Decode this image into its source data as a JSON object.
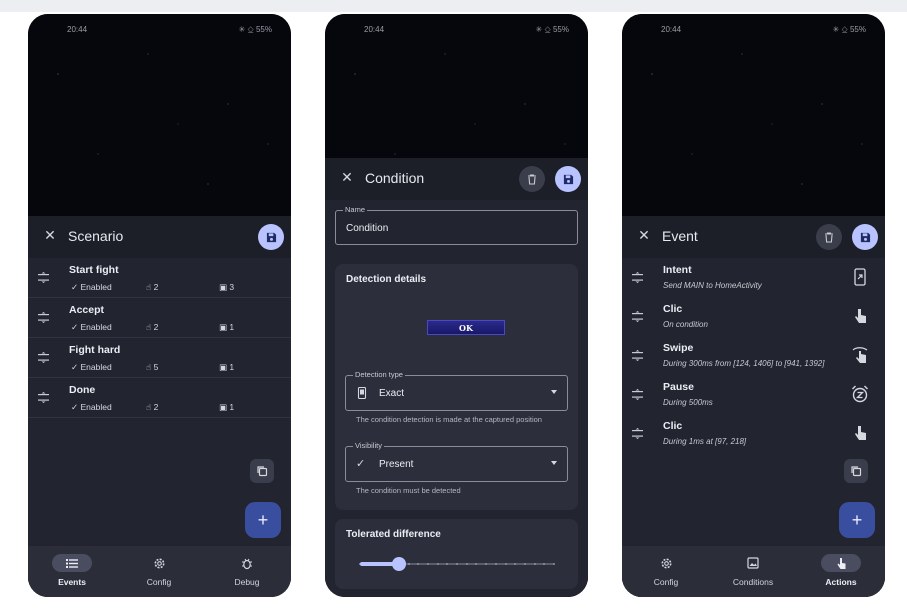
{
  "status": {
    "time": "20:44",
    "battery": "✳ ⎐ 55%"
  },
  "scenario": {
    "title": "Scenario",
    "events": [
      {
        "name": "Start fight",
        "enabled": "Enabled",
        "actions": "2",
        "conditions": "3"
      },
      {
        "name": "Accept",
        "enabled": "Enabled",
        "actions": "2",
        "conditions": "1"
      },
      {
        "name": "Fight hard",
        "enabled": "Enabled",
        "actions": "5",
        "conditions": "1"
      },
      {
        "name": "Done",
        "enabled": "Enabled",
        "actions": "2",
        "conditions": "1"
      }
    ],
    "fab_label": "+",
    "nav": [
      {
        "label": "Events"
      },
      {
        "label": "Config"
      },
      {
        "label": "Debug"
      }
    ]
  },
  "condition": {
    "title": "Condition",
    "name_label": "Name",
    "name_value": "Condition",
    "detection_title": "Detection details",
    "image_text": "OK",
    "detection_type_label": "Detection type",
    "detection_type_value": "Exact",
    "detection_helper": "The condition detection is made at the captured position",
    "visibility_label": "Visibility",
    "visibility_value": "Present",
    "visibility_helper": "The condition must be detected",
    "tolerance_title": "Tolerated difference",
    "slider_fraction": 0.2
  },
  "event": {
    "title": "Event",
    "actions": [
      {
        "name": "Intent",
        "desc": "Send MAIN to HomeActivity",
        "icon": "intent-icon"
      },
      {
        "name": "Clic",
        "desc": "On condition",
        "icon": "click-icon"
      },
      {
        "name": "Swipe",
        "desc": "During 300ms from [124, 1406] to [941, 1392]",
        "icon": "swipe-icon"
      },
      {
        "name": "Pause",
        "desc": "During 500ms",
        "icon": "alarm-icon"
      },
      {
        "name": "Clic",
        "desc": "During 1ms at [97, 218]",
        "icon": "click-icon"
      }
    ],
    "fab_label": "+",
    "nav": [
      {
        "label": "Config"
      },
      {
        "label": "Conditions"
      },
      {
        "label": "Actions"
      }
    ]
  }
}
